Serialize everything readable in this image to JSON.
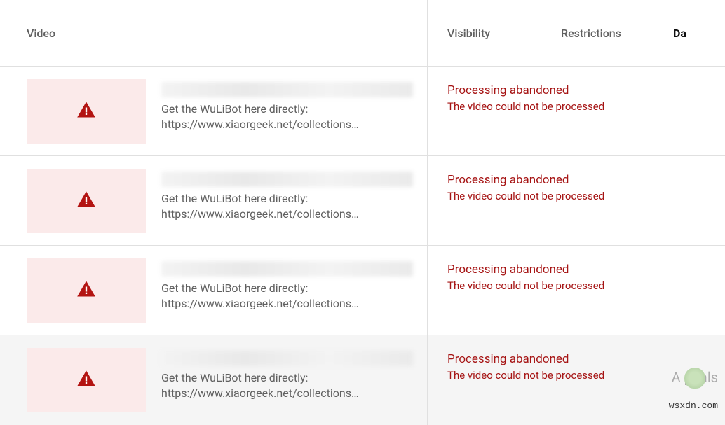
{
  "header": {
    "video": "Video",
    "visibility": "Visibility",
    "restrictions": "Restrictions",
    "date": "Da"
  },
  "rows": [
    {
      "desc": "Get the WuLiBot here directly: https://www.xiaorgeek.net/collections…",
      "status_title": "Processing abandoned",
      "status_sub": "The video could not be processed"
    },
    {
      "desc": "Get the WuLiBot here directly: https://www.xiaorgeek.net/collections…",
      "status_title": "Processing abandoned",
      "status_sub": "The video could not be processed"
    },
    {
      "desc": "Get the WuLiBot here directly: https://www.xiaorgeek.net/collections…",
      "status_title": "Processing abandoned",
      "status_sub": "The video could not be processed"
    },
    {
      "desc": "Get the WuLiBot here directly: https://www.xiaorgeek.net/collections…",
      "status_title": "Processing abandoned",
      "status_sub": "The video could not be processed"
    }
  ],
  "watermark": "A     puals",
  "footer": "wsxdn.com"
}
